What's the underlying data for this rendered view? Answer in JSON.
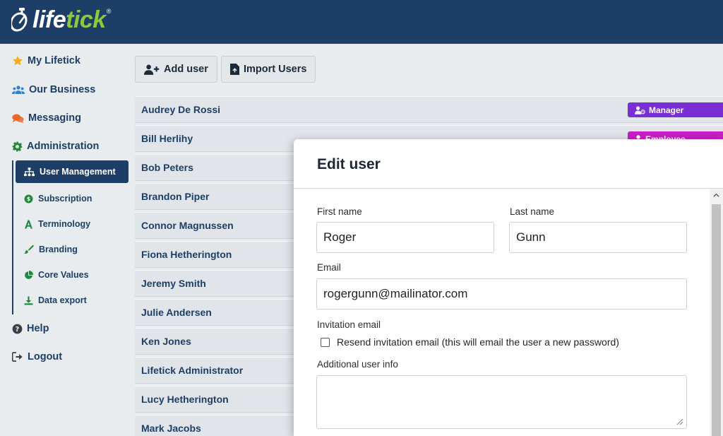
{
  "app": {
    "brand_left": "life",
    "brand_right": "tick",
    "brand_mark": "®"
  },
  "colors": {
    "header": "#1d3e66",
    "accent_green": "#8fc73e",
    "manager_badge": "#7a2ed6",
    "employee_badge": "#c81ec4"
  },
  "sidebar": {
    "items": [
      {
        "label": "My Lifetick",
        "icon": "star-icon"
      },
      {
        "label": "Our Business",
        "icon": "users-icon"
      },
      {
        "label": "Messaging",
        "icon": "comments-icon"
      },
      {
        "label": "Administration",
        "icon": "gear-icon"
      },
      {
        "label": "Help",
        "icon": "question-circle-icon"
      },
      {
        "label": "Logout",
        "icon": "sign-out-icon"
      }
    ],
    "subitems": [
      {
        "label": "User Management",
        "icon": "sitemap-icon",
        "active": true
      },
      {
        "label": "Subscription",
        "icon": "dollar-circle-icon"
      },
      {
        "label": "Terminology",
        "icon": "letter-a-icon"
      },
      {
        "label": "Branding",
        "icon": "paint-brush-icon"
      },
      {
        "label": "Core Values",
        "icon": "pie-chart-icon"
      },
      {
        "label": "Data export",
        "icon": "download-icon"
      }
    ]
  },
  "toolbar": {
    "add_user": "Add user",
    "import_users": "Import Users"
  },
  "users": [
    "Audrey De Rossi",
    "Bill Herlihy",
    "Bob Peters",
    "Brandon Piper",
    "Connor Magnussen",
    "Fiona Hetherington",
    "Jeremy Smith",
    "Julie Andersen",
    "Ken Jones",
    "Lifetick Administrator",
    "Lucy Hetherington",
    "Mark Jacobs"
  ],
  "badges": {
    "manager": "Manager",
    "employee": "Employee"
  },
  "modal": {
    "title": "Edit user",
    "first_name_label": "First name",
    "first_name_value": "Roger",
    "last_name_label": "Last name",
    "last_name_value": "Gunn",
    "email_label": "Email",
    "email_value": "rogergunn@mailinator.com",
    "invitation_label": "Invitation email",
    "resend_label": "Resend invitation email (this will email the user a new password)",
    "additional_label": "Additional user info"
  }
}
